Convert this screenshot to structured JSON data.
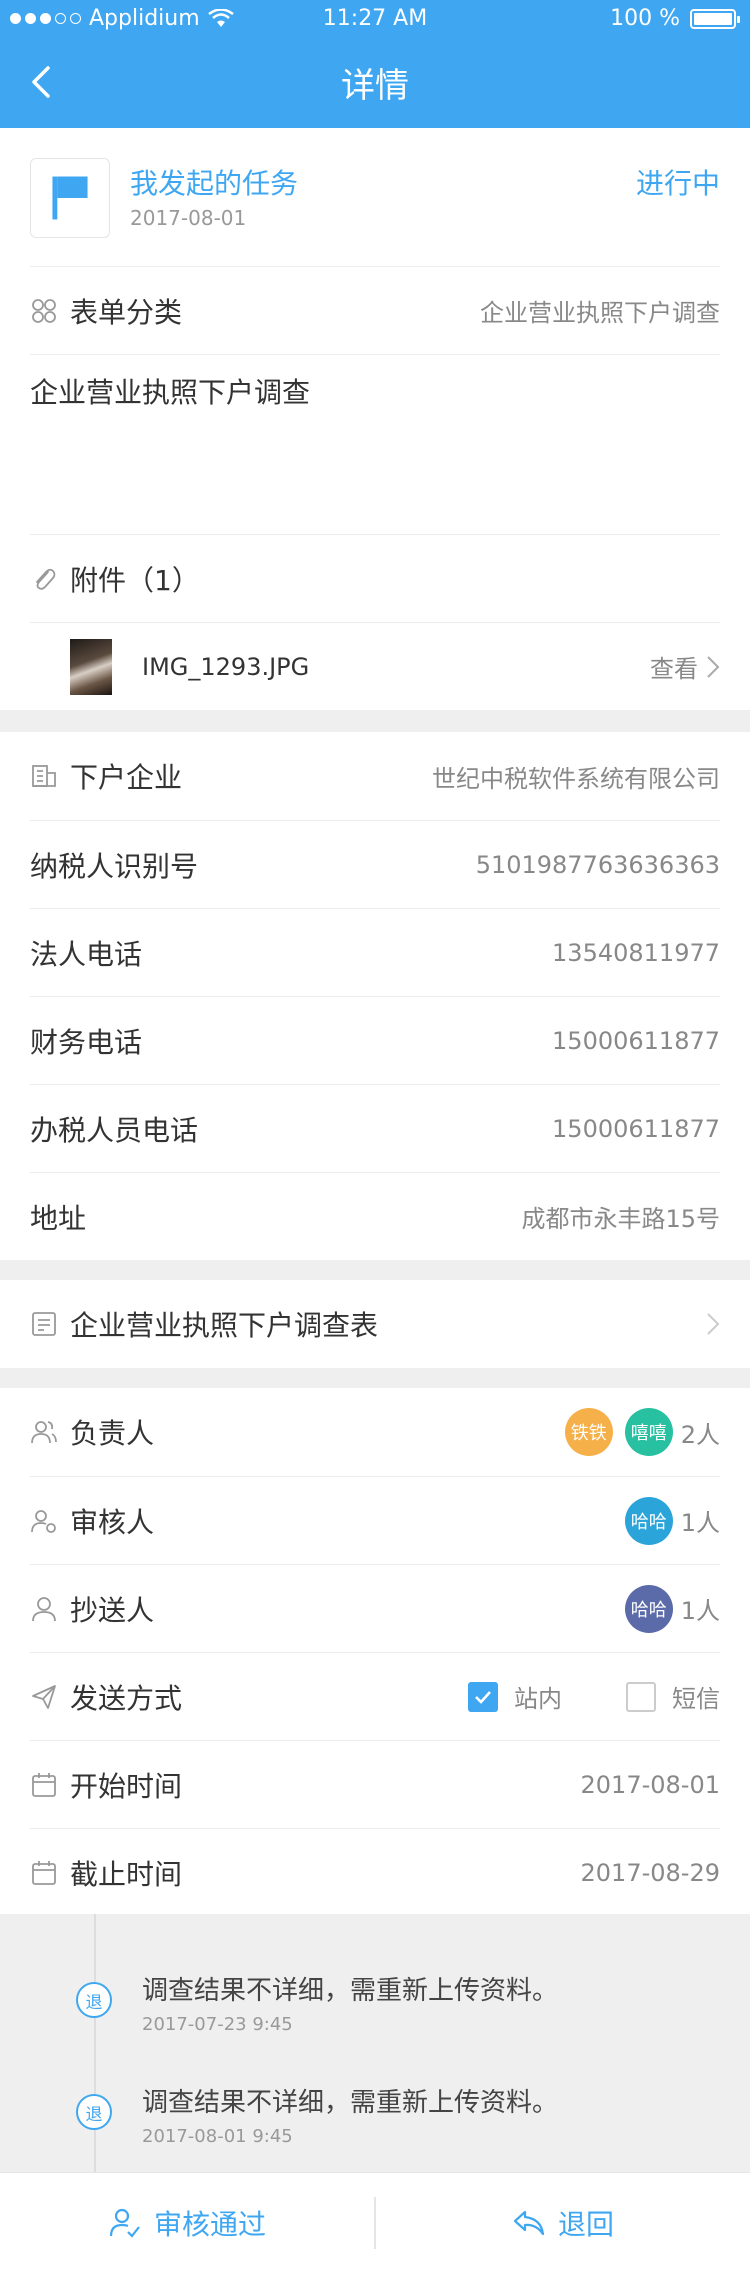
{
  "status_bar": {
    "carrier": "Applidium",
    "time": "11:27 AM",
    "battery": "100 %"
  },
  "nav": {
    "title": "详情"
  },
  "task": {
    "title": "我发起的任务",
    "date": "2017-08-01",
    "status": "进行中"
  },
  "form": {
    "category_label": "表单分类",
    "category_value": "企业营业执照下户调查",
    "description": "企业营业执照下户调查"
  },
  "attachments": {
    "label": "附件（1）",
    "file_name": "IMG_1293.JPG",
    "view_label": "查看"
  },
  "company": {
    "rows": [
      {
        "label": "下户企业",
        "value": "世纪中税软件系统有限公司"
      },
      {
        "label": "纳税人识别号",
        "value": "5101987763636363"
      },
      {
        "label": "法人电话",
        "value": "13540811977"
      },
      {
        "label": "财务电话",
        "value": "15000611877"
      },
      {
        "label": "办税人员电话",
        "value": "15000611877"
      },
      {
        "label": "地址",
        "value": "成都市永丰路15号"
      }
    ]
  },
  "survey_form": {
    "label": "企业营业执照下户调查表"
  },
  "people": {
    "responsible": {
      "label": "负责人",
      "avatars": [
        "铁铁",
        "嘻嘻"
      ],
      "count": "2人"
    },
    "reviewer": {
      "label": "审核人",
      "avatars": [
        "哈哈"
      ],
      "count": "1人"
    },
    "cc": {
      "label": "抄送人",
      "avatars": [
        "哈哈"
      ],
      "count": "1人"
    }
  },
  "send_method": {
    "label": "发送方式",
    "option1": "站内",
    "option1_checked": true,
    "option2": "短信",
    "option2_checked": false
  },
  "dates": {
    "start_label": "开始时间",
    "start_value": "2017-08-01",
    "end_label": "截止时间",
    "end_value": "2017-08-29"
  },
  "timeline": [
    {
      "badge": "退",
      "text": "调查结果不详细，需重新上传资料。",
      "time": "2017-07-23 9:45"
    },
    {
      "badge": "退",
      "text": "调查结果不详细，需重新上传资料。",
      "time": "2017-08-01 9:45"
    }
  ],
  "actions": {
    "approve": "审核通过",
    "return": "退回"
  },
  "colors": {
    "accent": "#3fa7f2",
    "avatar_orange": "#f5b04a",
    "avatar_green": "#27c0a0",
    "avatar_teal": "#2ba4d9",
    "avatar_indigo": "#5b6aa8"
  }
}
